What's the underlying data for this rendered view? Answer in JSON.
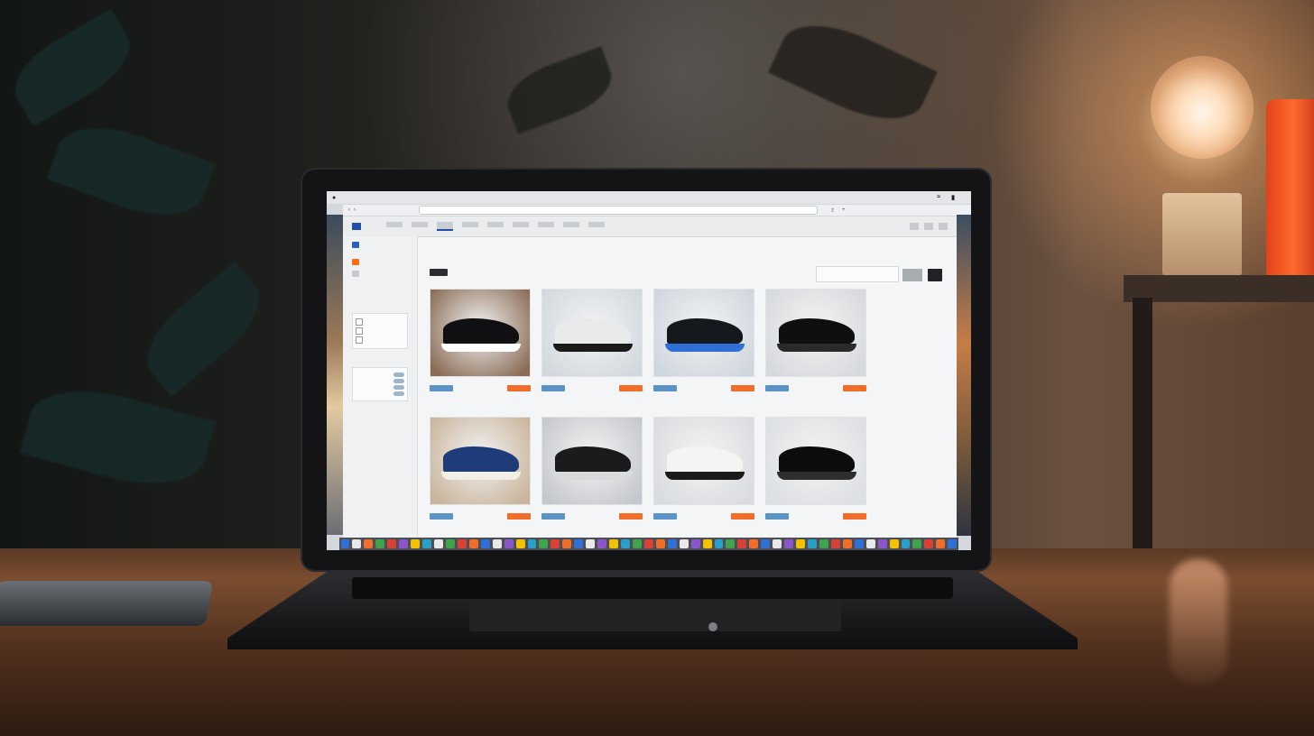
{
  "app": {
    "title": "",
    "menu": [
      "",
      "",
      "",
      "",
      "",
      "",
      "",
      ""
    ],
    "status": ""
  },
  "header": {
    "logo_text": "",
    "nav_links": [
      {
        "label": "",
        "active": false
      },
      {
        "label": "",
        "active": false
      },
      {
        "label": "",
        "active": true
      },
      {
        "label": "",
        "active": false
      },
      {
        "label": "",
        "active": false
      },
      {
        "label": "",
        "active": false
      },
      {
        "label": "",
        "active": false
      },
      {
        "label": "",
        "active": false
      },
      {
        "label": "",
        "active": false
      }
    ]
  },
  "sidebar": {
    "items": [
      {
        "label": "",
        "icon": "home-icon",
        "color": "#ff6c1a"
      },
      {
        "label": "",
        "icon": "tag-icon",
        "color": "#c7cace"
      },
      {
        "label": "",
        "icon": "user-icon",
        "color": "#c7cace"
      }
    ],
    "filters": [
      {
        "heading": "",
        "options": [
          "",
          "",
          ""
        ]
      },
      {
        "heading": "",
        "options": [
          "",
          "",
          "",
          ""
        ]
      }
    ]
  },
  "main": {
    "title": "",
    "breadcrumb_accent": "",
    "subtitle": "",
    "toolbar_text": "",
    "sort_label": "",
    "sort_value": ""
  },
  "products": [
    {
      "name": "",
      "price": "",
      "shoe_color": "#101012",
      "accent": "#ffffff",
      "bg": "#8a6c55"
    },
    {
      "name": "",
      "price": "",
      "shoe_color": "#e9eaec",
      "accent": "#1a1a1a",
      "bg": "#d2d8de"
    },
    {
      "name": "",
      "price": "",
      "shoe_color": "#15181c",
      "accent": "#2f6fd6",
      "bg": "#cfd6dd"
    },
    {
      "name": "",
      "price": "",
      "shoe_color": "#0f0f11",
      "accent": "#2a2a2a",
      "bg": "#d6d9dc"
    },
    {
      "name": "",
      "price": "",
      "shoe_color": "#1e3b7a",
      "accent": "#f3efe6",
      "bg": "#c9b49a"
    },
    {
      "name": "",
      "price": "",
      "shoe_color": "#1b1b1d",
      "accent": "#d9dadc",
      "bg": "#c4c7cb"
    },
    {
      "name": "",
      "price": "",
      "shoe_color": "#f4f4f2",
      "accent": "#1a1a1a",
      "bg": "#d9dcdf"
    },
    {
      "name": "",
      "price": "",
      "shoe_color": "#0c0c0e",
      "accent": "#2e2e2e",
      "bg": "#dcdfe2"
    }
  ],
  "colors": {
    "brand": "#1f4fa8",
    "accent": "#ff6c1a",
    "cart_button": "#f06e2a",
    "view_button": "#5c93c6"
  },
  "dock_icons": [
    "#2f6fd6",
    "#e8e8e8",
    "#f06e2a",
    "#3fa34d",
    "#d94136",
    "#8b56c9",
    "#f2c200",
    "#2b9ec7",
    "#e8e8e8",
    "#3fa34d",
    "#d94136",
    "#f06e2a",
    "#2f6fd6",
    "#e8e8e8",
    "#8b56c9",
    "#f2c200",
    "#2b9ec7",
    "#3fa34d",
    "#d94136",
    "#f06e2a",
    "#2f6fd6",
    "#e8e8e8",
    "#8b56c9",
    "#f2c200",
    "#2b9ec7",
    "#3fa34d",
    "#d94136",
    "#f06e2a",
    "#2f6fd6",
    "#e8e8e8",
    "#8b56c9",
    "#f2c200",
    "#2b9ec7",
    "#3fa34d",
    "#d94136",
    "#f06e2a",
    "#2f6fd6",
    "#e8e8e8",
    "#8b56c9",
    "#f2c200",
    "#2b9ec7",
    "#3fa34d",
    "#d94136",
    "#f06e2a",
    "#2f6fd6",
    "#e8e8e8",
    "#8b56c9",
    "#f2c200",
    "#2b9ec7",
    "#3fa34d",
    "#d94136",
    "#f06e2a",
    "#2f6fd6"
  ]
}
